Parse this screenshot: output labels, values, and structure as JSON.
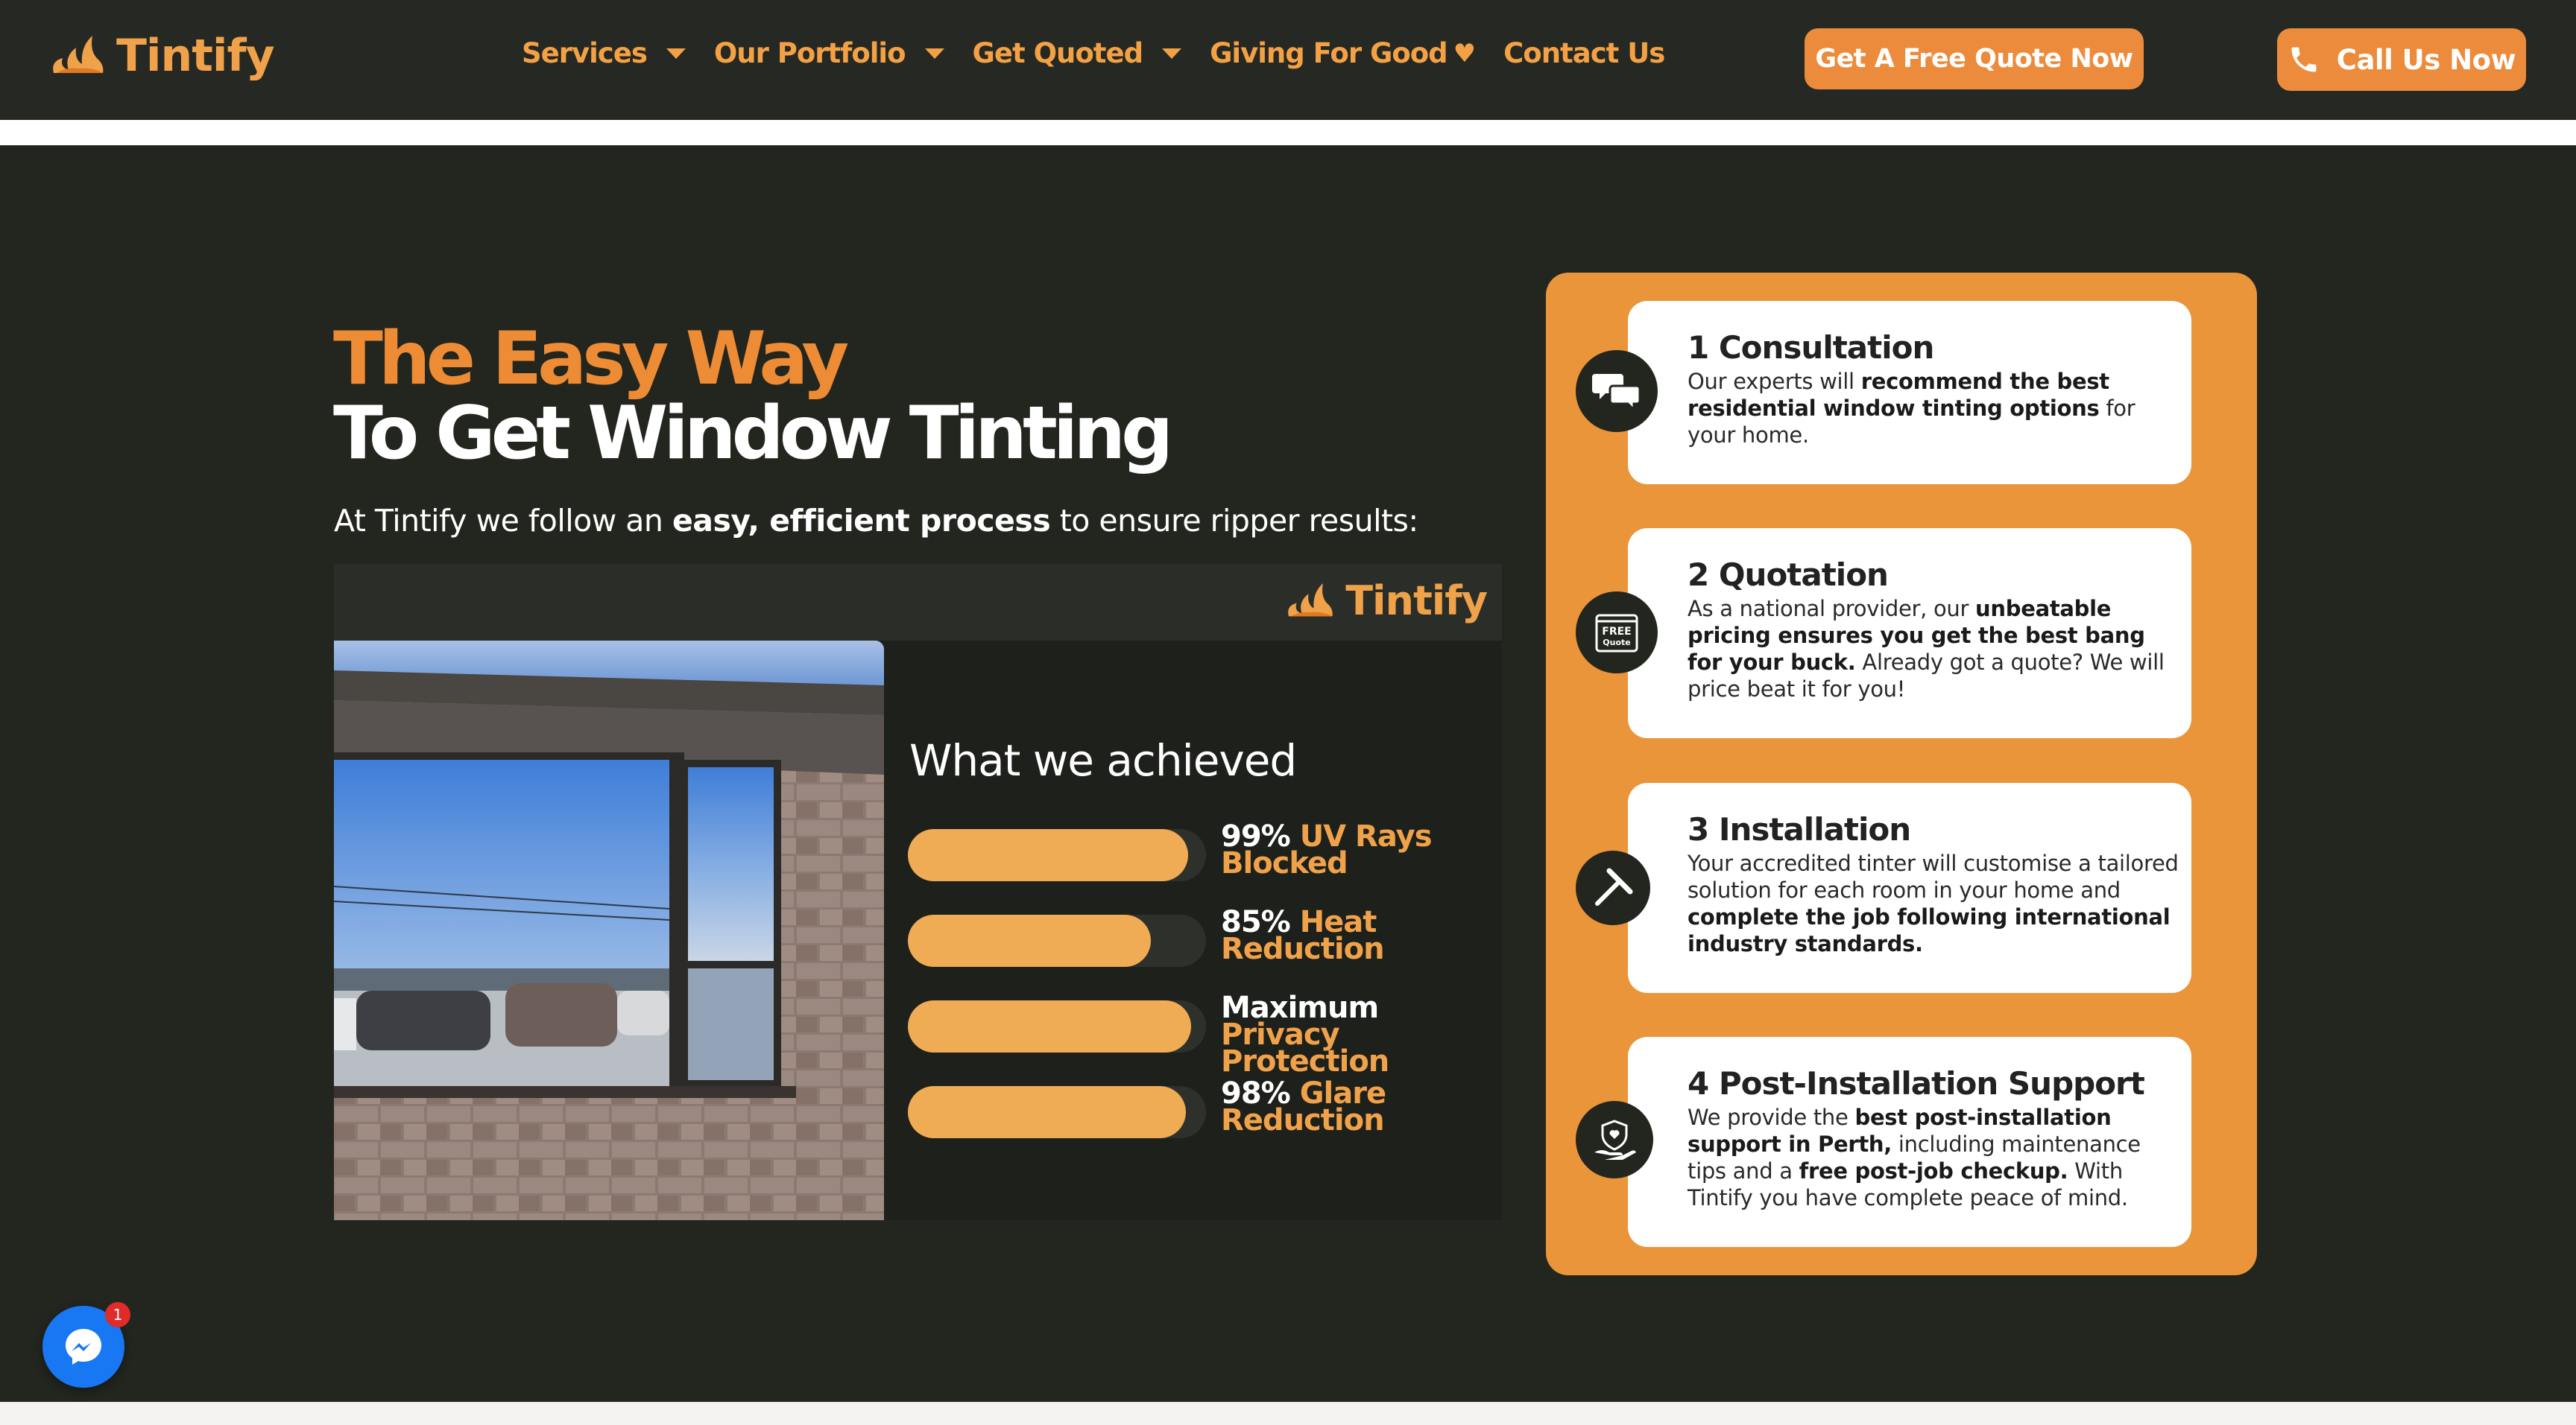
{
  "header": {
    "logo_text": "Tintify",
    "nav": [
      {
        "label": "Services",
        "has_caret": true
      },
      {
        "label": "Our Portfolio",
        "has_caret": true
      },
      {
        "label": "Get Quoted",
        "has_caret": true
      },
      {
        "label": "Giving For Good",
        "has_heart": true
      },
      {
        "label": "Contact Us"
      }
    ],
    "quote_button": "Get A Free Quote Now",
    "call_button": "Call Us Now"
  },
  "hero": {
    "title_line1": "The Easy Way",
    "title_line2": "To Get Window Tinting",
    "sub_pre": "At Tintify we follow an ",
    "sub_bold": "easy, efficient process",
    "sub_post": " to ensure ripper results:"
  },
  "video": {
    "logo_text": "Tintify",
    "heading": "What we achieved",
    "stats": [
      {
        "value": "99%",
        "label_line1": "UV Rays",
        "label_line2": "Blocked",
        "fill_percent": 99
      },
      {
        "value": "85%",
        "label_line1": "Heat",
        "label_line2": "Reduction",
        "fill_percent": 85
      },
      {
        "value": "Maximum",
        "label_line1": "Privacy",
        "label_line2": "Protection",
        "fill_percent": 100
      },
      {
        "value": "98%",
        "label_line1": "Glare",
        "label_line2": "Reduction",
        "fill_percent": 98
      }
    ]
  },
  "steps": [
    {
      "title": "1 Consultation",
      "icon": "chat-bubbles-icon",
      "parts": [
        {
          "t": "Our experts will ",
          "b": false
        },
        {
          "t": "recommend the best residential window tinting options",
          "b": true
        },
        {
          "t": " for your home.",
          "b": false
        }
      ]
    },
    {
      "title": "2 Quotation",
      "icon": "free-quote-icon",
      "icon_text_1": "FREE",
      "icon_text_2": "Quote",
      "parts": [
        {
          "t": "As a national provider, our ",
          "b": false
        },
        {
          "t": "unbeatable pricing ensures you get the best bang for your buck.",
          "b": true
        },
        {
          "t": " Already got a quote? We will price beat it for you!",
          "b": false
        }
      ]
    },
    {
      "title": "3 Installation",
      "icon": "squeegee-icon",
      "parts": [
        {
          "t": "Your accredited tinter will customise a tailored solution for each room in your home and ",
          "b": false
        },
        {
          "t": "complete the job following international industry standards.",
          "b": true
        }
      ]
    },
    {
      "title": "4 Post-Installation Support",
      "icon": "support-hand-icon",
      "parts": [
        {
          "t": "We provide the ",
          "b": false
        },
        {
          "t": "best post-installation support in Perth,",
          "b": true
        },
        {
          "t": " including maintenance tips and a ",
          "b": false
        },
        {
          "t": "free post-job checkup.",
          "b": true
        },
        {
          "t": " With Tintify you have complete peace of mind.",
          "b": false
        }
      ]
    }
  ],
  "messenger": {
    "badge_count": "1"
  },
  "colors": {
    "accent": "#ee8b35",
    "nav_text": "#f3a144",
    "background": "#23261f",
    "panel": "#ea953a",
    "bar_fill": "#f0ab55"
  }
}
